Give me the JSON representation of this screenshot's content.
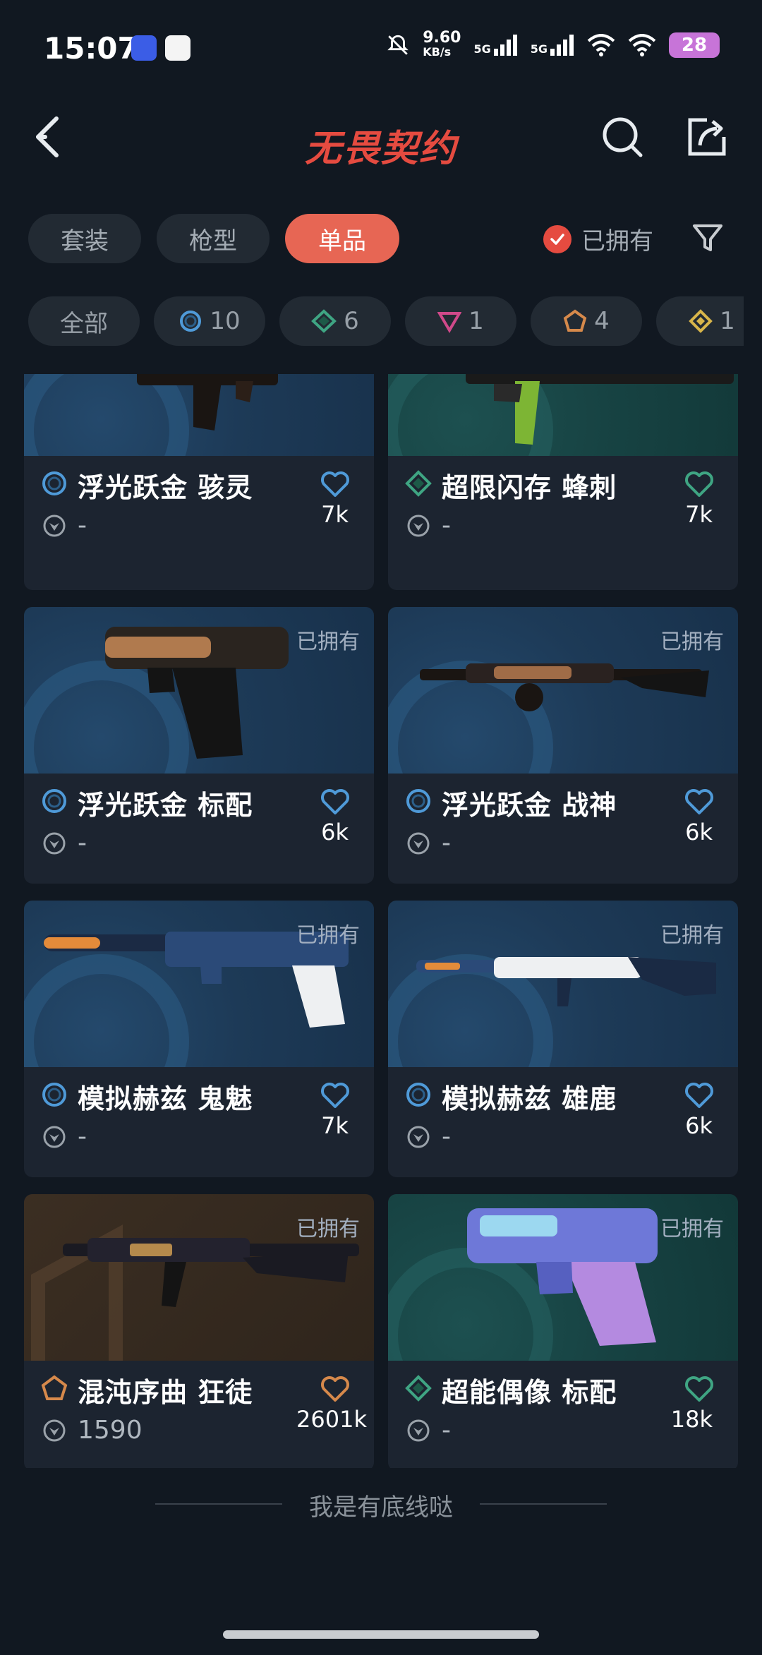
{
  "status": {
    "time": "15:07",
    "net_speed": "9.60",
    "net_unit": "KB/s",
    "sig1": "5G",
    "sig2": "5G",
    "battery": "28"
  },
  "header": {
    "title": "无畏契约"
  },
  "tabs": [
    {
      "label": "套装",
      "active": false
    },
    {
      "label": "枪型",
      "active": false
    },
    {
      "label": "单品",
      "active": true
    }
  ],
  "owned_filter": {
    "label": "已拥有",
    "checked": true
  },
  "chips": [
    {
      "label": "全部"
    },
    {
      "count": "10",
      "icon": "circle-ring-icon",
      "color": "#4f9ad8"
    },
    {
      "count": "6",
      "icon": "diamond-icon",
      "color": "#3fa583"
    },
    {
      "count": "1",
      "icon": "triangle-icon",
      "color": "#d0498a"
    },
    {
      "count": "4",
      "icon": "pentagon-icon",
      "color": "#d6894b"
    },
    {
      "count": "1",
      "icon": "rhombus-icon",
      "color": "#d8b54a"
    }
  ],
  "cards": [
    {
      "name": "浮光跃金 骇灵",
      "rarity": "ring",
      "rarity_color": "#4f9ad8",
      "heart_color": "#4f9ad8",
      "price": "-",
      "likes": "7k",
      "owned": false,
      "bg": "blue"
    },
    {
      "name": "超限闪存 蜂刺",
      "rarity": "diamond",
      "rarity_color": "#3fa583",
      "heart_color": "#3fa583",
      "price": "-",
      "likes": "7k",
      "owned": false,
      "bg": "teal"
    },
    {
      "name": "浮光跃金 标配",
      "rarity": "ring",
      "rarity_color": "#4f9ad8",
      "heart_color": "#4f9ad8",
      "price": "-",
      "likes": "6k",
      "owned": true,
      "owned_label": "已拥有",
      "bg": "blue"
    },
    {
      "name": "浮光跃金 战神",
      "rarity": "ring",
      "rarity_color": "#4f9ad8",
      "heart_color": "#4f9ad8",
      "price": "-",
      "likes": "6k",
      "owned": true,
      "owned_label": "已拥有",
      "bg": "blue"
    },
    {
      "name": "模拟赫兹 鬼魅",
      "rarity": "ring",
      "rarity_color": "#4f9ad8",
      "heart_color": "#4f9ad8",
      "price": "-",
      "likes": "7k",
      "owned": true,
      "owned_label": "已拥有",
      "bg": "blue"
    },
    {
      "name": "模拟赫兹 雄鹿",
      "rarity": "ring",
      "rarity_color": "#4f9ad8",
      "heart_color": "#4f9ad8",
      "price": "-",
      "likes": "6k",
      "owned": true,
      "owned_label": "已拥有",
      "bg": "blue"
    },
    {
      "name": "混沌序曲 狂徒",
      "rarity": "pentagon",
      "rarity_color": "#d6894b",
      "heart_color": "#d6894b",
      "price": "1590",
      "likes": "2601k",
      "owned": true,
      "owned_label": "已拥有",
      "bg": "brown"
    },
    {
      "name": "超能偶像 标配",
      "rarity": "diamond",
      "rarity_color": "#3fa583",
      "heart_color": "#3fa583",
      "price": "-",
      "likes": "18k",
      "owned": true,
      "owned_label": "已拥有",
      "bg": "teal"
    }
  ],
  "footer": {
    "text": "我是有底线哒"
  }
}
